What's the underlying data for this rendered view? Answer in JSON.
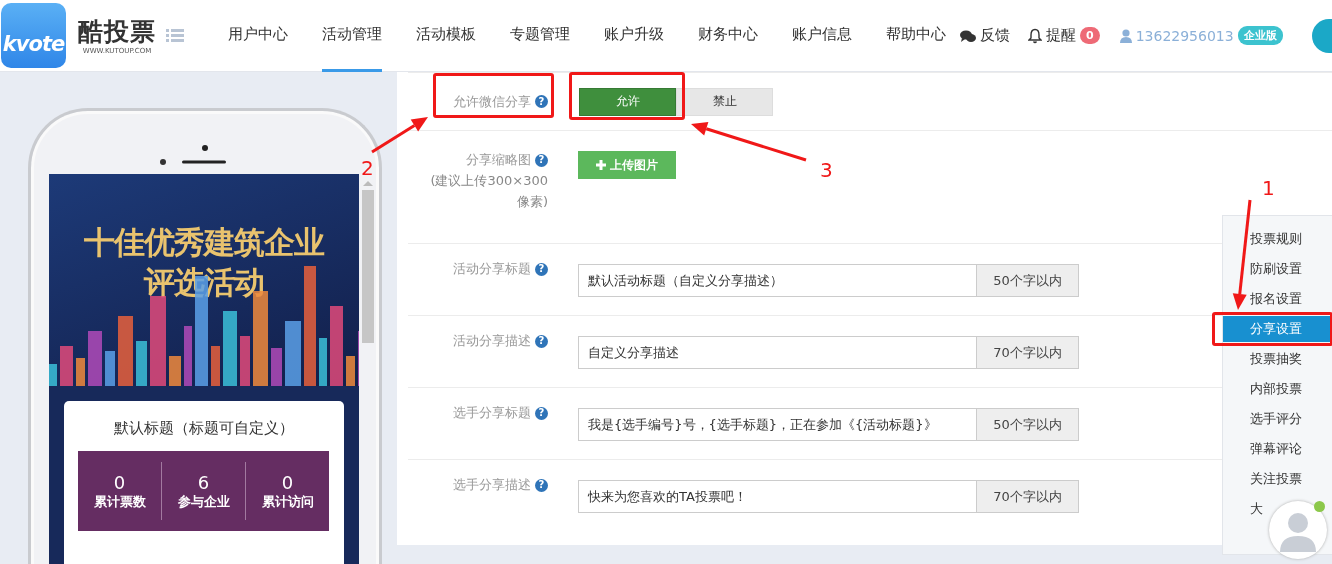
{
  "header": {
    "logo": {
      "mark": "kvote",
      "name": "酷投票",
      "url": "WWW.KUTOUP.COM"
    },
    "nav": [
      {
        "label": "用户中心",
        "selected": false
      },
      {
        "label": "活动管理",
        "selected": true
      },
      {
        "label": "活动模板",
        "selected": false
      },
      {
        "label": "专题管理",
        "selected": false
      },
      {
        "label": "账户升级",
        "selected": false
      },
      {
        "label": "财务中心",
        "selected": false
      },
      {
        "label": "账户信息",
        "selected": false
      },
      {
        "label": "帮助中心",
        "selected": false
      }
    ],
    "feedback": "反馈",
    "reminder": {
      "label": "提醒",
      "count": "0"
    },
    "user": {
      "phone": "13622956013",
      "badge": "企业版"
    }
  },
  "preview": {
    "banner_title": [
      "十佳优秀建筑企业",
      "评选活动"
    ],
    "card_title": "默认标题（标题可自定义）",
    "stats": [
      {
        "value": "0",
        "label": "累计票数"
      },
      {
        "value": "6",
        "label": "参与企业"
      },
      {
        "value": "0",
        "label": "累计访问"
      }
    ]
  },
  "form": {
    "allow_share": {
      "label": "允许微信分享",
      "help": "?",
      "options": [
        {
          "label": "允许",
          "selected": true
        },
        {
          "label": "禁止",
          "selected": false
        }
      ]
    },
    "thumbnail": {
      "label": "分享缩略图",
      "help": "?",
      "hint": "(建议上传300×300像素)",
      "button": "上传图片"
    },
    "fields": [
      {
        "label": "活动分享标题",
        "help": "?",
        "value": "默认活动标题（自定义分享描述）",
        "limit": "50个字以内"
      },
      {
        "label": "活动分享描述",
        "help": "?",
        "value": "自定义分享描述",
        "limit": "70个字以内"
      },
      {
        "label": "选手分享标题",
        "help": "?",
        "value": "我是{选手编号}号，{选手标题}，正在参加《{活动标题}》",
        "limit": "50个字以内"
      },
      {
        "label": "选手分享描述",
        "help": "?",
        "value": "快来为您喜欢的TA投票吧！",
        "limit": "70个字以内"
      }
    ]
  },
  "side_menu": [
    {
      "label": "投票规则",
      "selected": false
    },
    {
      "label": "防刷设置",
      "selected": false
    },
    {
      "label": "报名设置",
      "selected": false
    },
    {
      "label": "分享设置",
      "selected": true
    },
    {
      "label": "投票抽奖",
      "selected": false
    },
    {
      "label": "内部投票",
      "selected": false
    },
    {
      "label": "选手评分",
      "selected": false
    },
    {
      "label": "弹幕评论",
      "selected": false
    },
    {
      "label": "关注投票",
      "selected": false
    },
    {
      "label": "大",
      "selected": false
    }
  ],
  "annotations": [
    "1",
    "2",
    "3"
  ]
}
